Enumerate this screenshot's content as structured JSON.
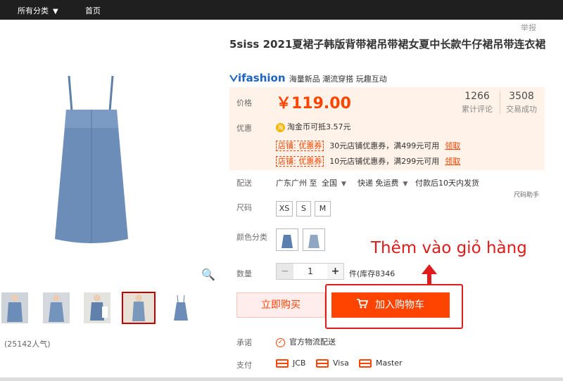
{
  "topbar": {
    "category_label": "所有分类",
    "home_label": "首页"
  },
  "report_label": "举报",
  "product": {
    "title": "5siss 2021夏裙子韩版背带裙吊带裙女夏中长款牛仔裙吊带连衣裙",
    "brand_logo": "ifashion",
    "brand_tags": "海量新品 潮流穿搭 玩趣互动"
  },
  "price": {
    "label": "价格",
    "value": "￥119.00",
    "reviews_count": "1266",
    "reviews_label": "累计评论",
    "sales_count": "3508",
    "sales_label": "交易成功"
  },
  "promo": {
    "label": "优惠",
    "coin_icon_text": "淘",
    "coin_text": "淘金币可抵3.57元",
    "coupons": [
      {
        "tag": "店铺: 优惠券",
        "desc": "30元店铺优惠券，满499元可用",
        "action": "领取"
      },
      {
        "tag": "店铺: 优惠券",
        "desc": "10元店铺优惠券，满299元可用",
        "action": "领取"
      }
    ]
  },
  "shipping": {
    "label": "配送",
    "from": "广东广州 至",
    "to": "全国",
    "fee": "快递 免运费",
    "time": "付款后10天内发货",
    "size_helper": "尺码助手"
  },
  "size": {
    "label": "尺码",
    "options": [
      "XS",
      "S",
      "M"
    ]
  },
  "color": {
    "label": "颜色分类"
  },
  "quantity": {
    "label": "数量",
    "value": "1",
    "minus": "−",
    "plus": "+",
    "stock": "件(库存8346"
  },
  "buttons": {
    "buy_now": "立即购买",
    "add_to_cart": "加入购物车"
  },
  "annotation": {
    "callout": "Thêm vào giỏ hàng"
  },
  "service": {
    "label": "承诺",
    "text": "官方物流配送"
  },
  "payment": {
    "label": "支付",
    "methods": [
      "JCB",
      "Visa",
      "Master"
    ]
  },
  "popularity": "(25142人气)",
  "colors": {
    "accent": "#ff4400",
    "annotation_red": "#e01b1b",
    "price_bg": "#fff2e8",
    "denim": "#6b8db8"
  }
}
